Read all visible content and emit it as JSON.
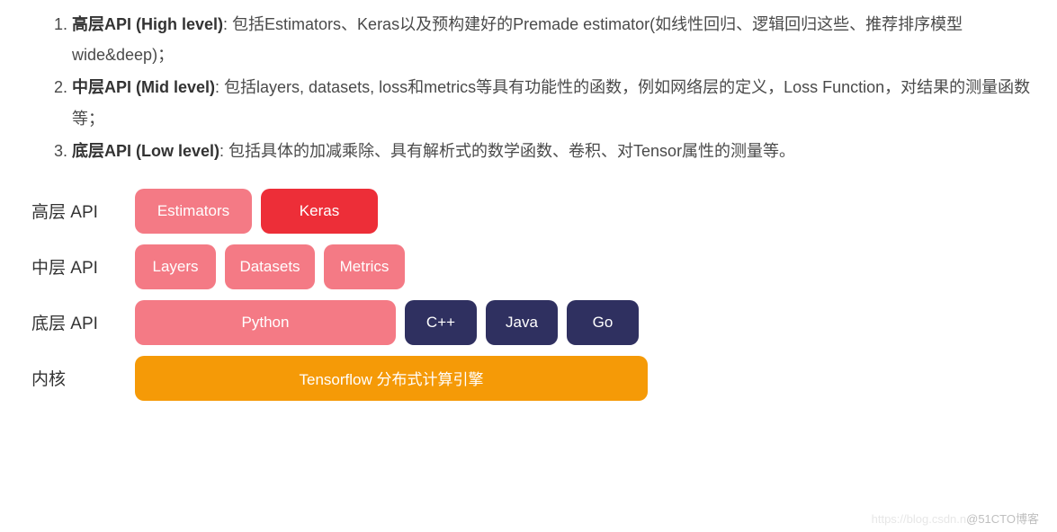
{
  "list": {
    "item1": {
      "title": "高层API (High level)",
      "desc": ": 包括Estimators、Keras以及预构建好的Premade estimator(如线性回归、逻辑回归这些、推荐排序模型wide&deep)；"
    },
    "item2": {
      "title": "中层API (Mid level)",
      "desc": ": 包括layers, datasets, loss和metrics等具有功能性的函数，例如网络层的定义，Loss Function，对结果的测量函数等；"
    },
    "item3": {
      "title": "底层API (Low level)",
      "desc": ": 包括具体的加减乘除、具有解析式的数学函数、卷积、对Tensor属性的测量等。"
    }
  },
  "diagram": {
    "row1": {
      "label": "高层 API",
      "estimators": "Estimators",
      "keras": "Keras"
    },
    "row2": {
      "label": "中层 API",
      "layers": "Layers",
      "datasets": "Datasets",
      "metrics": "Metrics"
    },
    "row3": {
      "label": "底层 API",
      "python": "Python",
      "cpp": "C++",
      "java": "Java",
      "go": "Go"
    },
    "row4": {
      "label": "内核",
      "kernel": "Tensorflow 分布式计算引擎"
    }
  },
  "watermark": {
    "faint": "https://blog.csdn.n",
    "text": "@51CTO博客"
  }
}
